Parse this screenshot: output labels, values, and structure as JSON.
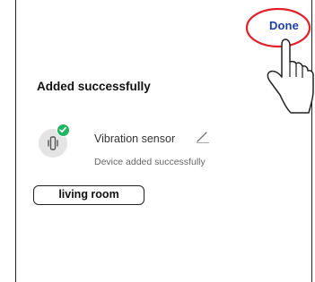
{
  "header": {
    "done_label": "Done"
  },
  "main": {
    "title": "Added successfully",
    "device": {
      "icon": "vibration-sensor-icon",
      "status_badge": "check-icon",
      "name": "Vibration sensor",
      "status": "Device added successfully"
    },
    "room": {
      "label": "living room"
    }
  },
  "colors": {
    "accent": "#1f3fa8",
    "success": "#20b463",
    "annotation": "#e2202a"
  }
}
